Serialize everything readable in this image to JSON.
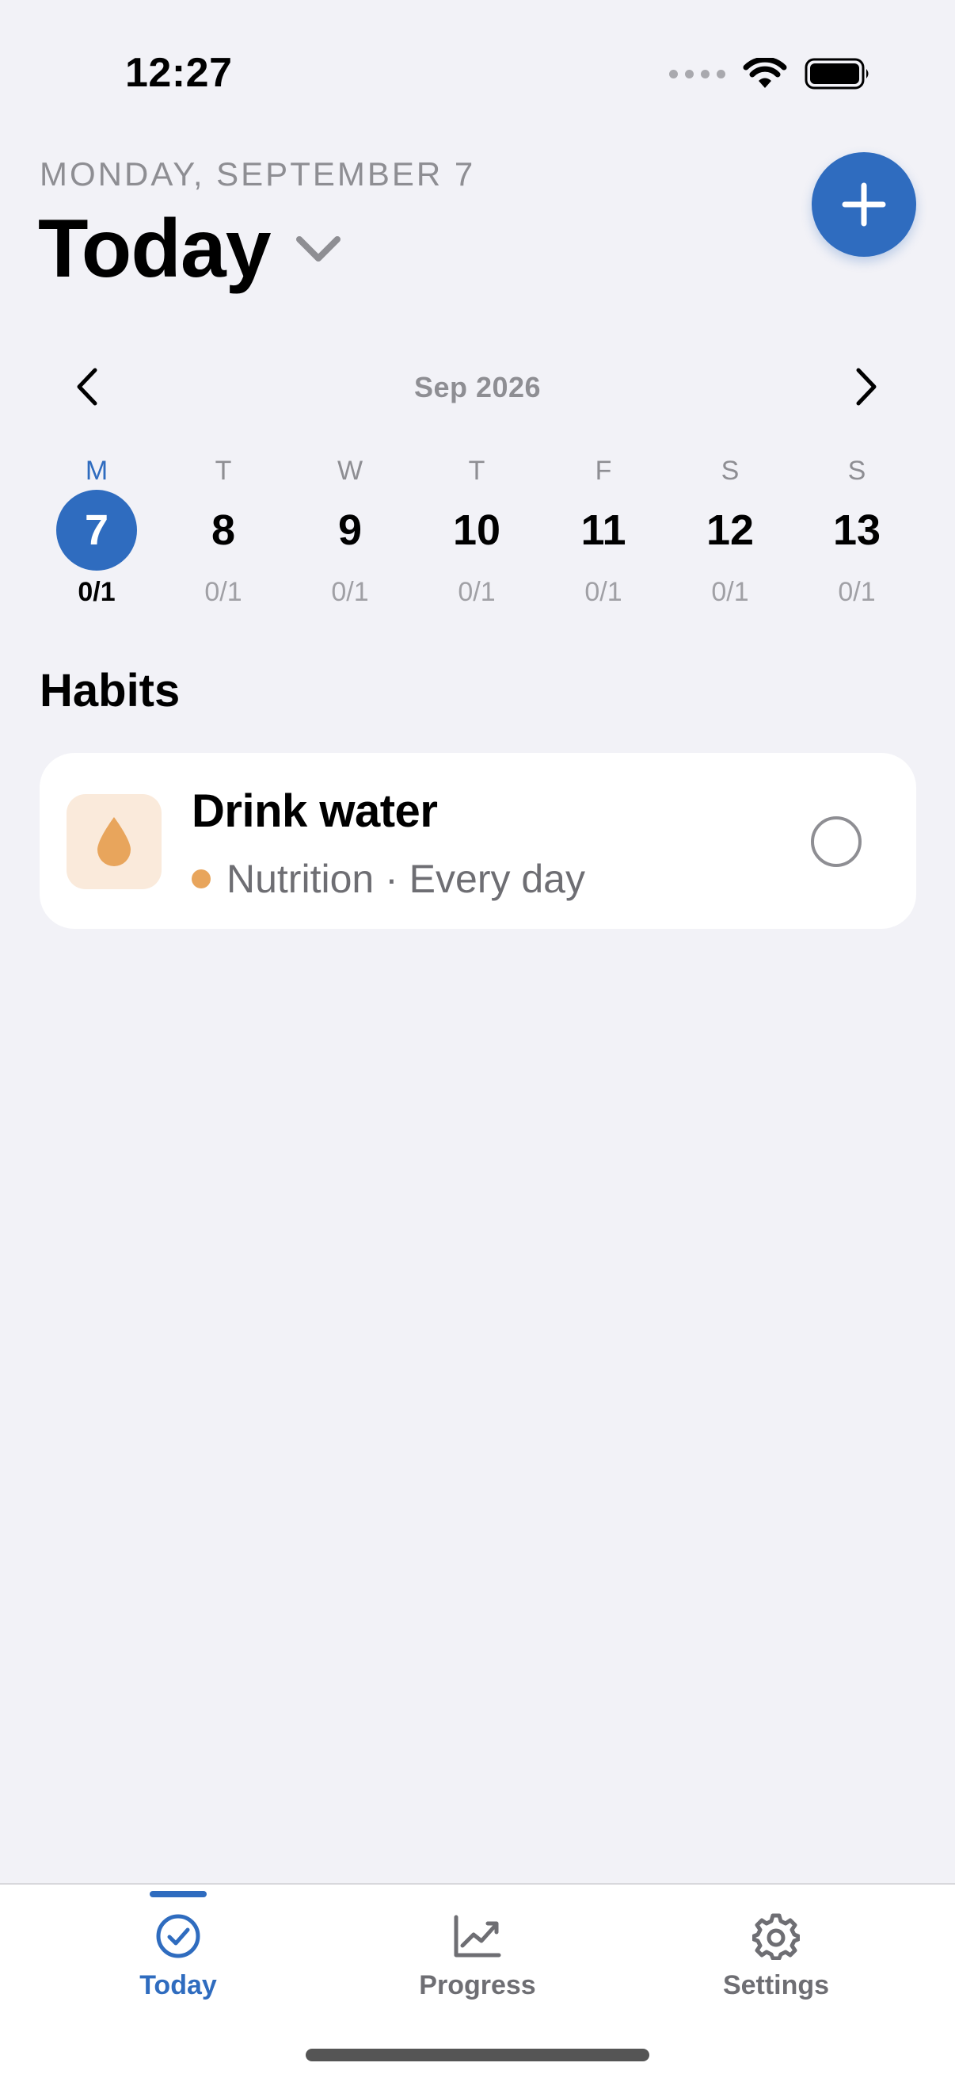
{
  "status_bar": {
    "time": "12:27"
  },
  "header": {
    "date": "MONDAY, SEPTEMBER 7",
    "title": "Today"
  },
  "calendar": {
    "month_label": "Sep 2026",
    "days": [
      {
        "dow": "M",
        "num": "7",
        "count": "0/1",
        "selected": true
      },
      {
        "dow": "T",
        "num": "8",
        "count": "0/1",
        "selected": false
      },
      {
        "dow": "W",
        "num": "9",
        "count": "0/1",
        "selected": false
      },
      {
        "dow": "T",
        "num": "10",
        "count": "0/1",
        "selected": false
      },
      {
        "dow": "F",
        "num": "11",
        "count": "0/1",
        "selected": false
      },
      {
        "dow": "S",
        "num": "12",
        "count": "0/1",
        "selected": false
      },
      {
        "dow": "S",
        "num": "13",
        "count": "0/1",
        "selected": false
      }
    ]
  },
  "habits": {
    "section_title": "Habits",
    "items": [
      {
        "name": "Drink water",
        "category": "Nutrition",
        "separator": "·",
        "frequency": "Every day",
        "icon": "water-drop-icon",
        "category_color": "#e8a55c",
        "completed": false
      }
    ]
  },
  "tabbar": {
    "tabs": [
      {
        "label": "Today",
        "icon": "check-circle-icon",
        "active": true
      },
      {
        "label": "Progress",
        "icon": "chart-line-icon",
        "active": false
      },
      {
        "label": "Settings",
        "icon": "gear-icon",
        "active": false
      }
    ]
  },
  "colors": {
    "accent": "#2f6cbf",
    "background": "#f2f2f7",
    "secondary_text": "#8e8e93"
  }
}
